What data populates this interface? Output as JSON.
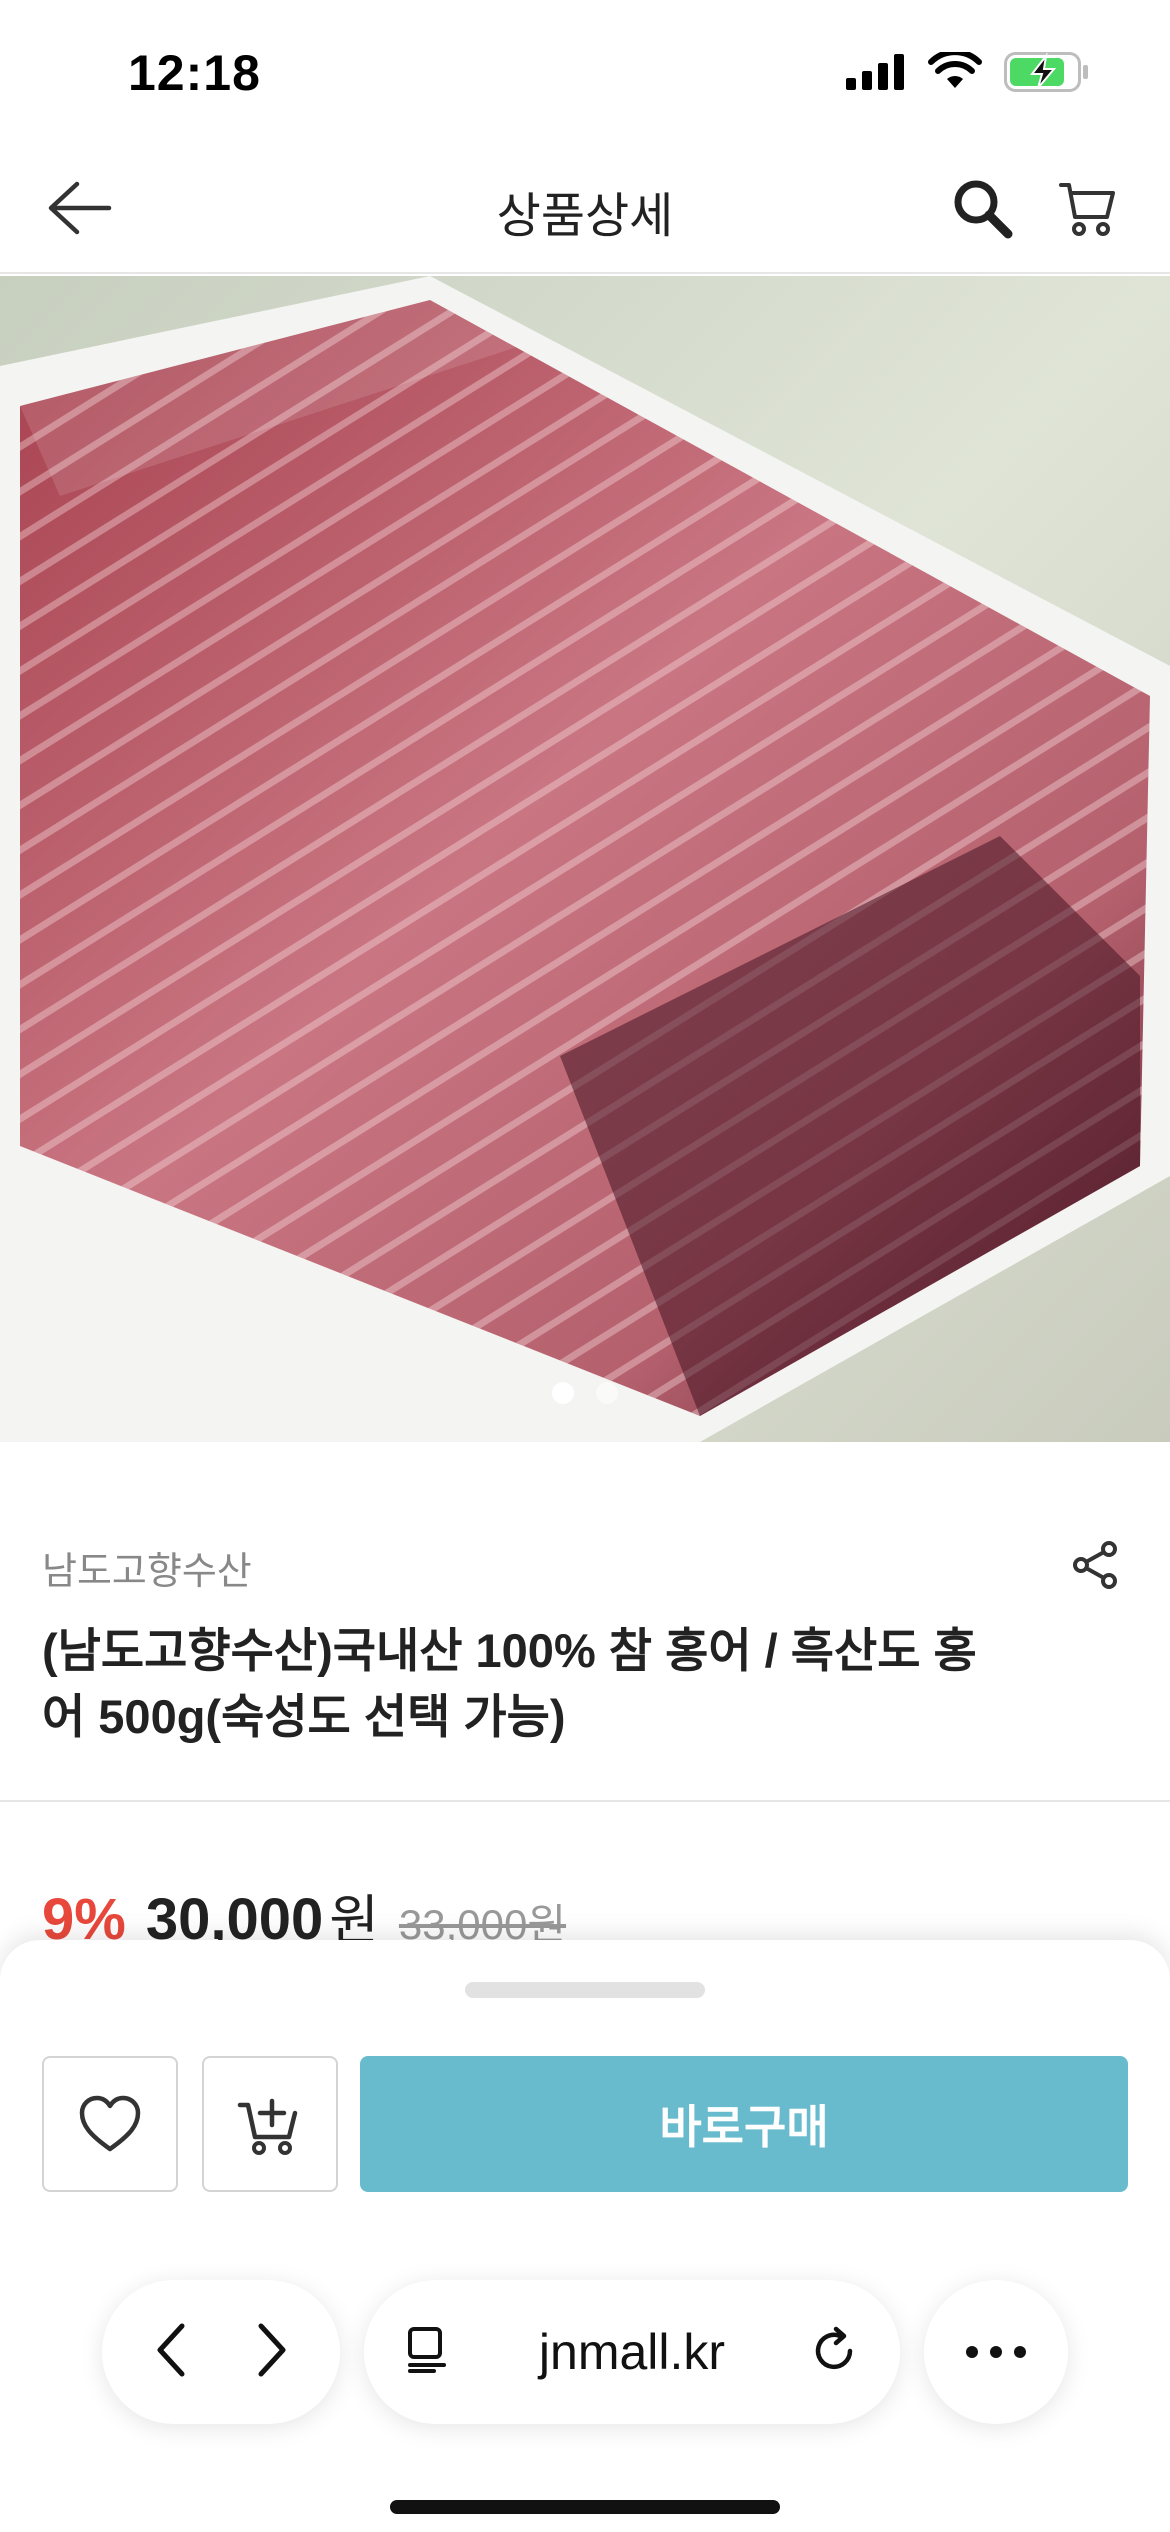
{
  "status": {
    "time": "12:18",
    "icons": [
      "signal-icon",
      "wifi-icon",
      "battery-charging-icon"
    ]
  },
  "header": {
    "title": "상품상세",
    "icons": [
      "back-arrow-icon",
      "search-icon",
      "cart-icon"
    ]
  },
  "product": {
    "image_alt": "sliced raw skate in foam box",
    "carousel": {
      "total": 2,
      "active": 1
    },
    "seller": "남도고향수산",
    "name": "(남도고향수산)국내산 100% 참 홍어 / 흑산도 홍어 500g(숙성도 선택 가능)",
    "discount": "9%",
    "price": "30,000",
    "price_unit": "원",
    "original_price": "33,000원"
  },
  "actions": {
    "buy_label": "바로구매",
    "icons": [
      "heart-icon",
      "cart-add-icon",
      "share-icon"
    ]
  },
  "browser": {
    "url": "jnmall.kr",
    "icons": [
      "chevron-left-icon",
      "chevron-right-icon",
      "tabs-icon",
      "reload-icon",
      "more-icon"
    ]
  },
  "colors": {
    "accent": "#68bacd",
    "discount": "#e8483b",
    "battery": "#4cd964"
  }
}
